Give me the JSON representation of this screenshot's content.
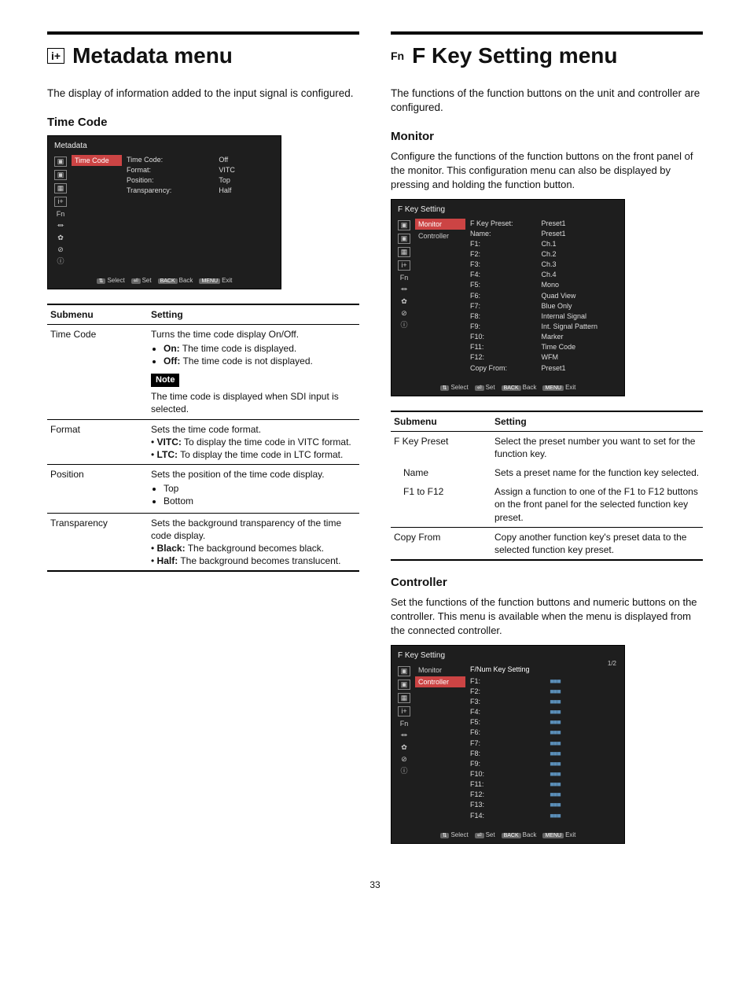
{
  "page_number": "33",
  "left": {
    "icon_label": "i+",
    "heading": "Metadata menu",
    "intro": "The display of information added to the input signal is configured.",
    "section": "Time Code",
    "osd": {
      "title": "Metadata",
      "icons": [
        "▣",
        "▣",
        "▦",
        "i+",
        "Fn",
        "⏛",
        "✿",
        "⊘",
        "ⓘ"
      ],
      "tab_selected": "Time Code",
      "rows": [
        [
          "Time Code:",
          "Off"
        ],
        [
          "Format:",
          "VITC"
        ],
        [
          "Position:",
          "Top"
        ],
        [
          "Transparency:",
          "Half"
        ]
      ],
      "footer": [
        [
          "⇅",
          "Select"
        ],
        [
          "⏎",
          "Set"
        ],
        [
          "BACK",
          "Back"
        ],
        [
          "MENU",
          "Exit"
        ]
      ]
    },
    "table_headers": [
      "Submenu",
      "Setting"
    ],
    "table": [
      {
        "sub": "Time Code",
        "lines": [
          "Turns the time code display On/Off."
        ],
        "bullets": [
          "On: The time code is displayed.",
          "Off: The time code is not displayed."
        ],
        "note": "The time code is displayed when SDI input is selected."
      },
      {
        "sub": "Format",
        "lines": [
          "Sets the time code format."
        ],
        "bullets2": [
          "VITC: To display the time code in VITC format.",
          "LTC: To display the time code in LTC format."
        ]
      },
      {
        "sub": "Position",
        "lines": [
          "Sets the position of the time code display."
        ],
        "bullets": [
          "Top",
          "Bottom"
        ]
      },
      {
        "sub": "Transparency",
        "lines": [
          "Sets the background transparency of the time code display."
        ],
        "bullets2": [
          "Black: The background becomes black.",
          "Half: The background becomes translucent."
        ]
      }
    ]
  },
  "right": {
    "icon_label": "Fn",
    "heading": "F Key Setting menu",
    "intro": "The functions of the function buttons on the unit and controller are configured.",
    "monitor": {
      "title": "Monitor",
      "desc": "Configure the functions of the function buttons on the front panel of the monitor. This configuration menu can also be displayed by pressing and holding the function button.",
      "osd": {
        "title": "F Key Setting",
        "icons": [
          "▣",
          "▣",
          "▦",
          "i+",
          "Fn",
          "⏛",
          "✿",
          "⊘",
          "ⓘ"
        ],
        "tabs": [
          "Monitor",
          "Controller"
        ],
        "selected": 0,
        "rows": [
          [
            "F Key Preset:",
            "Preset1"
          ],
          [
            "Name:",
            "Preset1"
          ],
          [
            "F1:",
            "Ch.1"
          ],
          [
            "F2:",
            "Ch.2"
          ],
          [
            "F3:",
            "Ch.3"
          ],
          [
            "F4:",
            "Ch.4"
          ],
          [
            "F5:",
            "Mono"
          ],
          [
            "F6:",
            "Quad View"
          ],
          [
            "F7:",
            "Blue Only"
          ],
          [
            "F8:",
            "Internal Signal"
          ],
          [
            "F9:",
            "Int. Signal Pattern"
          ],
          [
            "F10:",
            "Marker"
          ],
          [
            "F11:",
            "Time Code"
          ],
          [
            "F12:",
            "WFM"
          ],
          [
            "Copy From:",
            "Preset1"
          ]
        ],
        "footer": [
          [
            "⇅",
            "Select"
          ],
          [
            "⏎",
            "Set"
          ],
          [
            "BACK",
            "Back"
          ],
          [
            "MENU",
            "Exit"
          ]
        ]
      },
      "table_headers": [
        "Submenu",
        "Setting"
      ],
      "table": [
        {
          "sub": "F Key Preset",
          "text": "Select the preset number you want to set for the function key."
        },
        {
          "sub": "Name",
          "indent": true,
          "text": "Sets a preset name for the function key selected."
        },
        {
          "sub": "F1 to F12",
          "indent": true,
          "text": "Assign a function to one of the F1 to F12 buttons on the front panel for the selected function key preset."
        },
        {
          "sub": "Copy From",
          "text": "Copy another function key's preset data to the selected function key preset."
        }
      ]
    },
    "controller": {
      "title": "Controller",
      "desc": "Set the functions of the function buttons and numeric buttons on the controller. This menu is available when the menu is displayed from the connected controller.",
      "osd": {
        "title": "F Key Setting",
        "page": "1/2",
        "icons": [
          "▣",
          "▣",
          "▦",
          "i+",
          "Fn",
          "⏛",
          "✿",
          "⊘",
          "ⓘ"
        ],
        "tabs": [
          "Monitor",
          "Controller"
        ],
        "selected": 1,
        "head": "F/Num Key Setting",
        "rows": [
          [
            "F1:",
            "■■■"
          ],
          [
            "F2:",
            "■■■"
          ],
          [
            "F3:",
            "■■■"
          ],
          [
            "F4:",
            "■■■"
          ],
          [
            "F5:",
            "■■■"
          ],
          [
            "F6:",
            "■■■"
          ],
          [
            "F7:",
            "■■■"
          ],
          [
            "F8:",
            "■■■"
          ],
          [
            "F9:",
            "■■■"
          ],
          [
            "F10:",
            "■■■"
          ],
          [
            "F11:",
            "■■■"
          ],
          [
            "F12:",
            "■■■"
          ],
          [
            "F13:",
            "■■■"
          ],
          [
            "F14:",
            "■■■"
          ]
        ],
        "footer": [
          [
            "⇅",
            "Select"
          ],
          [
            "⏎",
            "Set"
          ],
          [
            "BACK",
            "Back"
          ],
          [
            "MENU",
            "Exit"
          ]
        ]
      }
    }
  }
}
